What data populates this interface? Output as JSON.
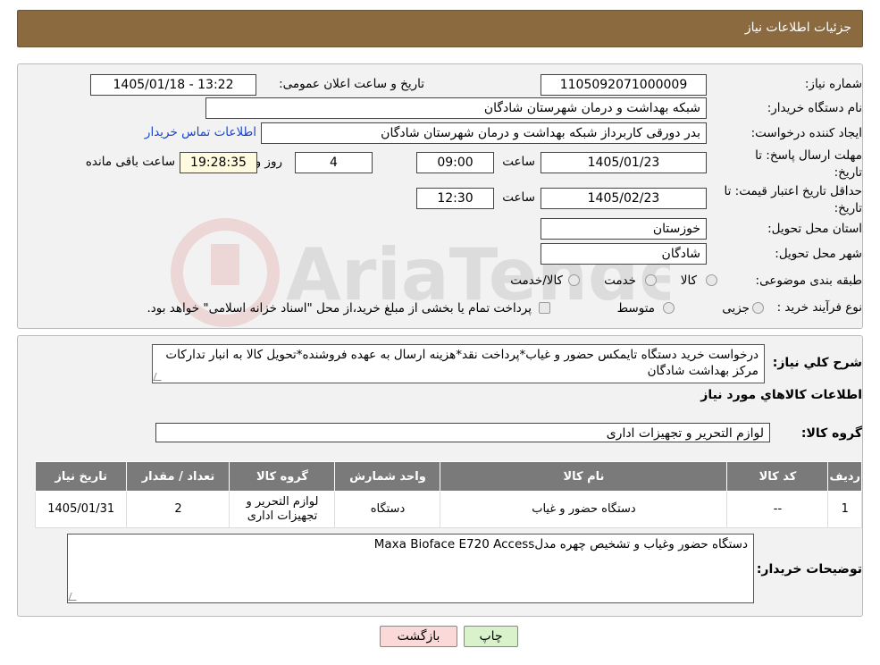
{
  "header": {
    "title": "جزئیات اطلاعات نیاز"
  },
  "form": {
    "need_number_label": "شماره نیاز:",
    "need_number": "1105092071000009",
    "announce_label": "تاریخ و ساعت اعلان عمومی:",
    "announce_value": "1405/01/18 - 13:22",
    "buyer_org_label": "نام دستگاه خریدار:",
    "buyer_org": "شبکه بهداشت و درمان شهرستان شادگان",
    "creator_label": "ایجاد کننده درخواست:",
    "creator": "بدر دورقی کاربرداز شبکه بهداشت و درمان شهرستان شادگان",
    "contact_link": "اطلاعات تماس خریدار",
    "deadline_label_1": "مهلت ارسال پاسخ: تا",
    "deadline_label_2": "تاریخ:",
    "deadline_date": "1405/01/23",
    "time_label": "ساعت",
    "deadline_time": "09:00",
    "days_value": "4",
    "days_label": "روز و",
    "remaining_time": "19:28:35",
    "remaining_label": "ساعت باقی مانده",
    "validity_label_1": "حداقل تاریخ اعتبار قیمت: تا",
    "validity_label_2": "تاریخ:",
    "validity_date": "1405/02/23",
    "validity_time": "12:30",
    "province_label": "استان محل تحویل:",
    "province": "خوزستان",
    "city_label": "شهر محل تحویل:",
    "city": "شادگان",
    "category_label": "طبقه بندی موضوعی:",
    "category_options": [
      "کالا",
      "خدمت",
      "کالا/خدمت"
    ],
    "purchase_type_label": "نوع فرآیند خرید :",
    "purchase_options": [
      "جزیی",
      "متوسط"
    ],
    "purchase_note": "پرداخت تمام یا بخشی از مبلغ خرید،از محل \"اسناد خزانه اسلامی\" خواهد بود."
  },
  "summary": {
    "label": "شرح کلي نياز:",
    "text": "درخواست خرید دستگاه تایمکس حضور و غیاب*پرداخت نقد*هزینه ارسال به عهده فروشنده*تحویل کالا به انبار تدارکات مرکز بهداشت شادگان"
  },
  "goods_section_title": "اطلاعات کالاهاي مورد نياز",
  "goods_group_label": "گروه کالا:",
  "goods_group": "لوازم التحریر و تجهیزات اداری",
  "table": {
    "headers": [
      "ردیف",
      "کد کالا",
      "نام کالا",
      "واحد شمارش",
      "گروه کالا",
      "تعداد / مقدار",
      "تاریخ نیاز"
    ],
    "rows": [
      [
        "1",
        "--",
        "دستگاه حضور و غیاب",
        "دستگاه",
        "لوازم التحریر و تجهیزات اداری",
        "2",
        "1405/01/31"
      ]
    ]
  },
  "buyer_notes_label": "توضیحات خریدار:",
  "buyer_notes": "دستگاه حضور وغیاب و تشخیص چهره مدلMaxa Bioface E720 Access",
  "buttons": {
    "print": "چاپ",
    "back": "بازگشت"
  },
  "watermark_text": "AriaTender.neT",
  "colors": {
    "header": "#8b6a3f",
    "link": "#1a47c9",
    "table_header": "#7a7a7a"
  }
}
